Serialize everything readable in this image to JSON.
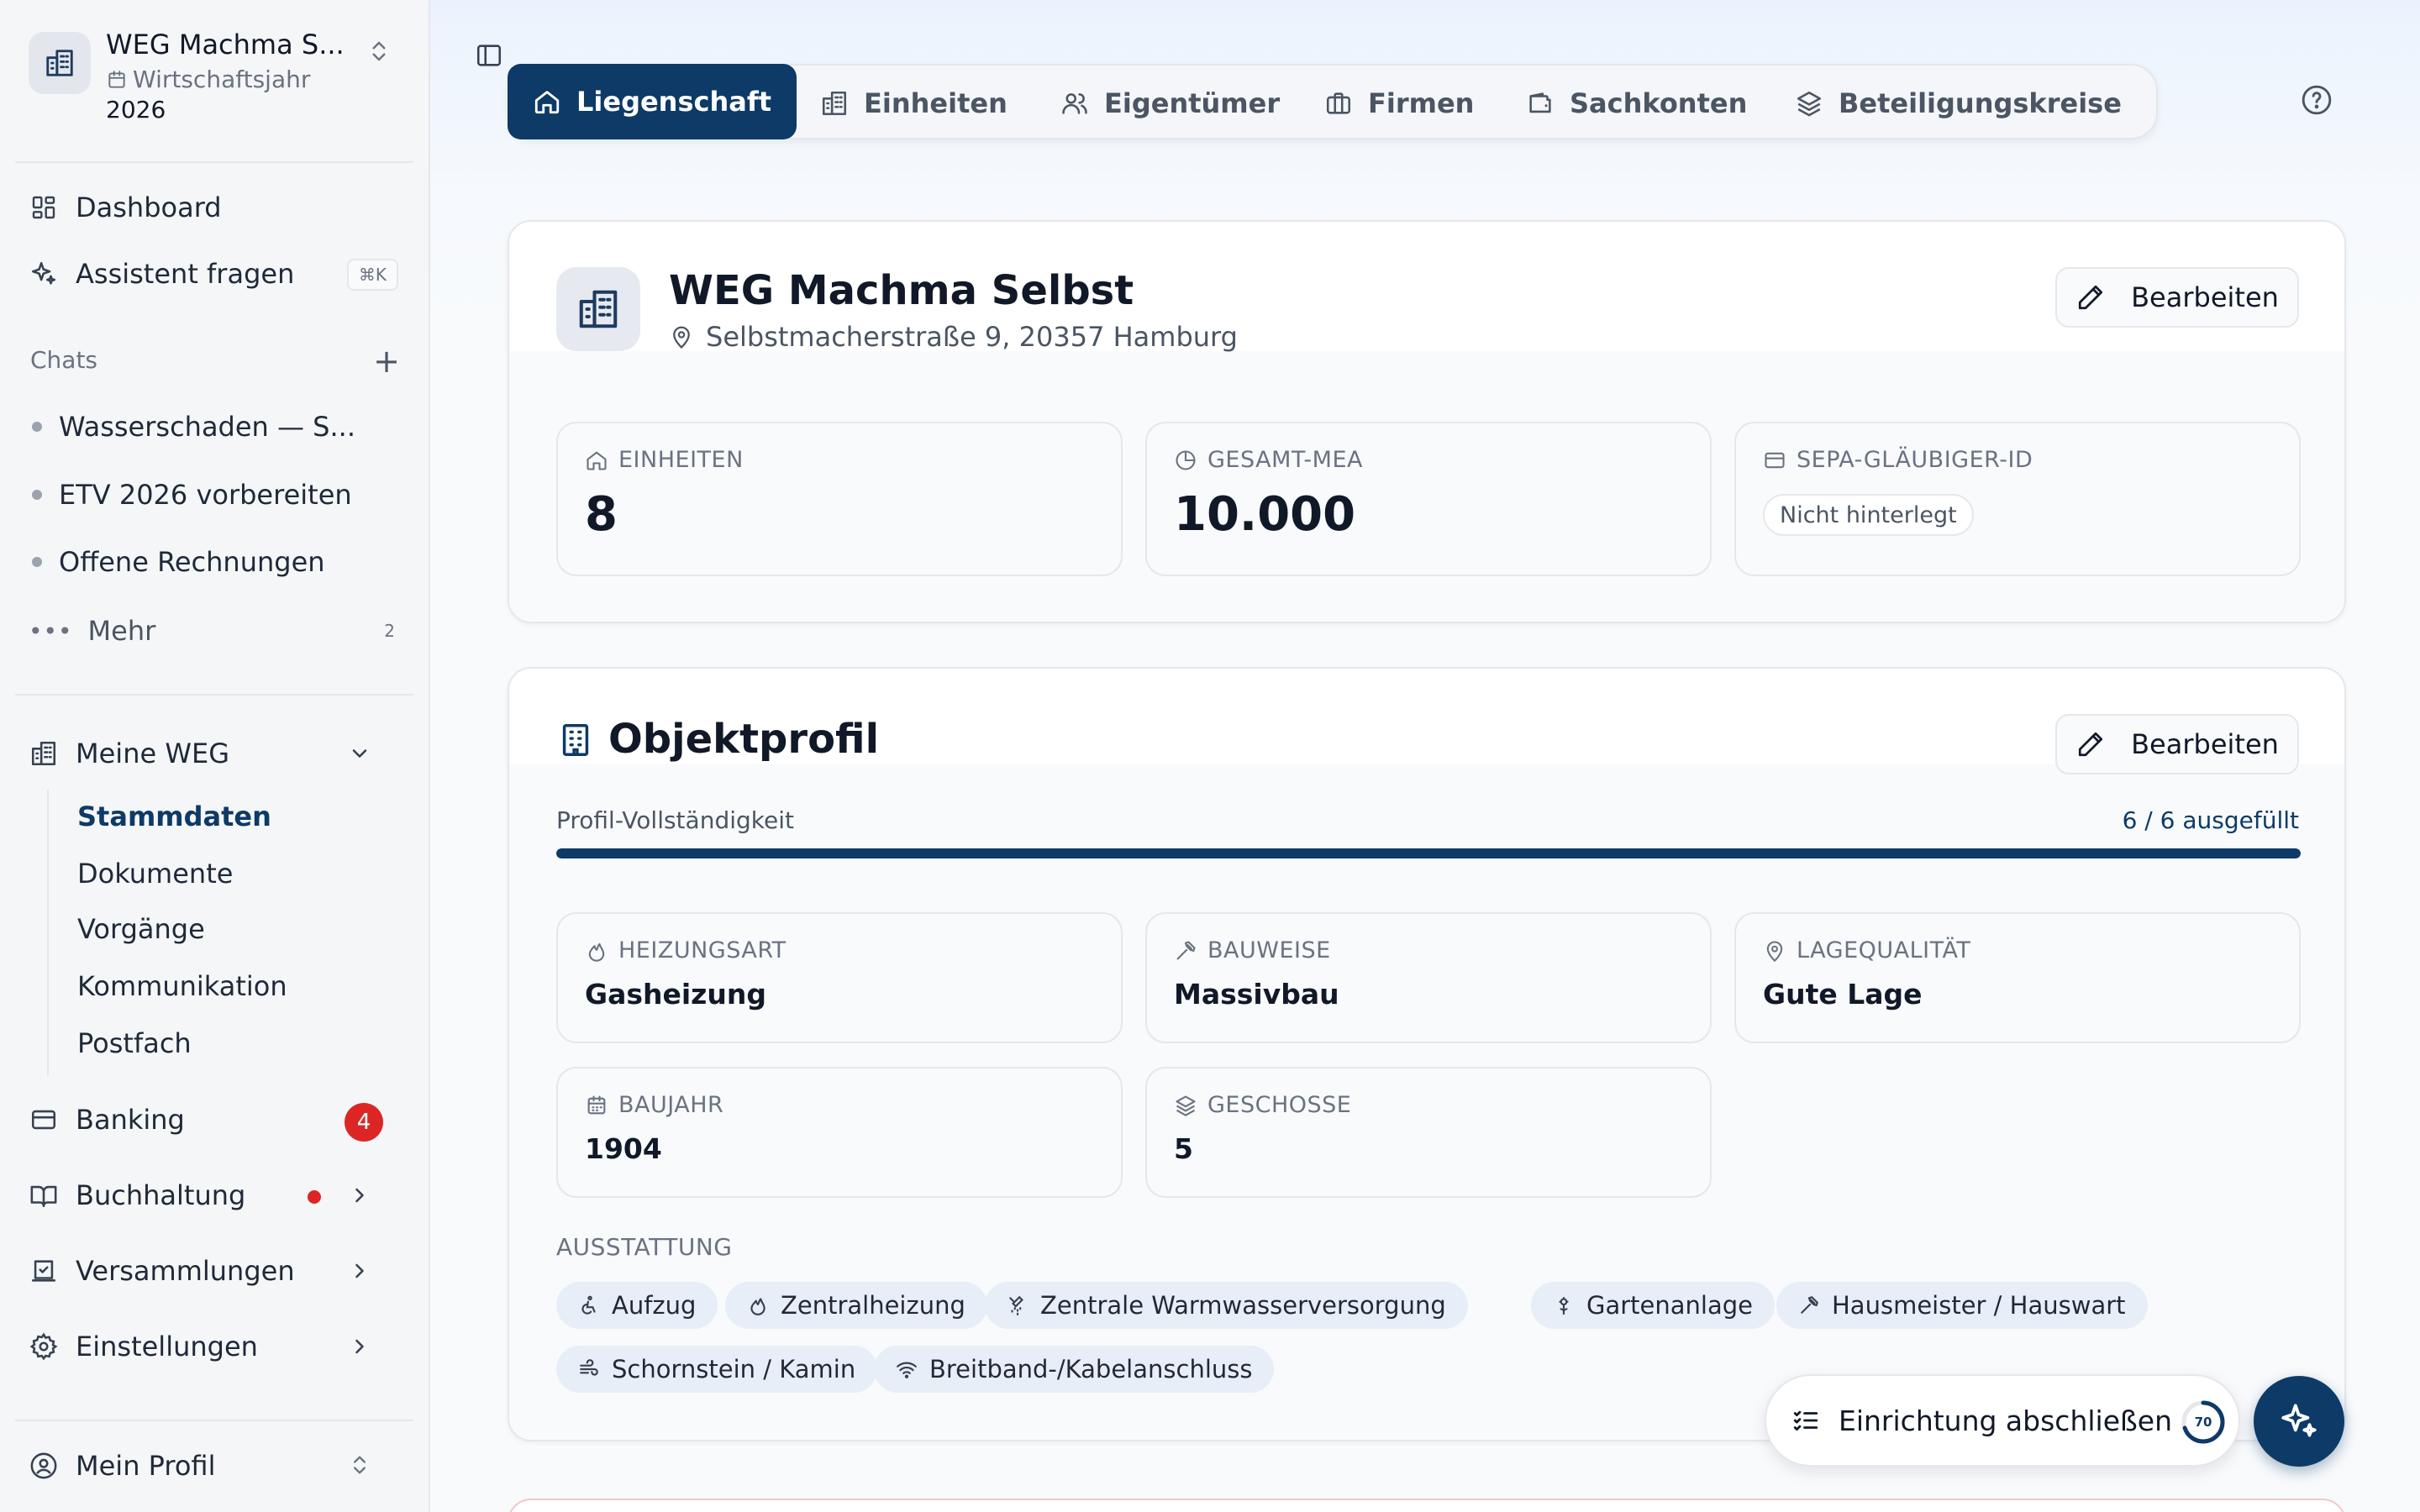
{
  "workspace": {
    "name": "WEG Machma S...",
    "fiscal_label": "Wirtschaftsjahr",
    "year": "2026"
  },
  "nav": {
    "dashboard": "Dashboard",
    "assistant": "Assistent fragen",
    "assistant_shortcut": "⌘K"
  },
  "chats": {
    "heading": "Chats",
    "items": [
      "Wasserschaden — S...",
      "ETV 2026 vorbereiten",
      "Offene Rechnungen"
    ],
    "more_label": "Mehr",
    "more_count": "2"
  },
  "meine_weg": {
    "label": "Meine WEG",
    "subitems": [
      "Stammdaten",
      "Dokumente",
      "Vorgänge",
      "Kommunikation",
      "Postfach"
    ],
    "active": "Stammdaten"
  },
  "sections": {
    "banking": "Banking",
    "banking_badge": "4",
    "buchhaltung": "Buchhaltung",
    "versammlungen": "Versammlungen",
    "einstellungen": "Einstellungen"
  },
  "profile": {
    "label": "Mein Profil"
  },
  "tabs": [
    "Liegenschaft",
    "Einheiten",
    "Eigentümer",
    "Firmen",
    "Sachkonten",
    "Beteiligungskreise"
  ],
  "active_tab": "Liegenschaft",
  "property": {
    "name": "WEG Machma Selbst",
    "address": "Selbstmacherstraße 9, 20357 Hamburg",
    "edit_label": "Bearbeiten",
    "stats": {
      "units_label": "EINHEITEN",
      "units_value": "8",
      "mea_label": "GESAMT-MEA",
      "mea_value": "10.000",
      "sepa_label": "SEPA-GLÄUBIGER-ID",
      "sepa_value": "Nicht hinterlegt"
    }
  },
  "objektprofil": {
    "title": "Objektprofil",
    "edit_label": "Bearbeiten",
    "progress_label": "Profil-Vollständigkeit",
    "progress_text": "6 / 6 ausgefüllt",
    "progress_fraction": 1.0,
    "fields": {
      "heizungsart_label": "HEIZUNGSART",
      "heizungsart_value": "Gasheizung",
      "bauweise_label": "BAUWEISE",
      "bauweise_value": "Massivbau",
      "lage_label": "LAGEQUALITÄT",
      "lage_value": "Gute Lage",
      "baujahr_label": "BAUJAHR",
      "baujahr_value": "1904",
      "geschosse_label": "GESCHOSSE",
      "geschosse_value": "5"
    },
    "ausstattung_label": "AUSSTATTUNG",
    "ausstattung": [
      "Aufzug",
      "Zentralheizung",
      "Zentrale Warmwasserversorgung",
      "Gartenanlage",
      "Hausmeister / Hauswart",
      "Schornstein / Kamin",
      "Breitband-/Kabelanschluss"
    ]
  },
  "setup": {
    "label": "Einrichtung abschließen",
    "progress": "70",
    "progress_fraction": 0.7
  },
  "colors": {
    "primary": "#0d3a66",
    "badge_red": "#dc2626",
    "chip_bg": "#e7eef7"
  },
  "icons": {
    "building": "building-icon",
    "calendar": "calendar-icon",
    "dashboard": "dashboard-grid-icon",
    "assistant": "sparkles-icon",
    "home": "home-icon",
    "users": "users-icon",
    "briefcase": "briefcase-icon",
    "wallet": "wallet-icon",
    "layers": "layers-icon",
    "help": "help-circle-icon",
    "edit": "pencil-icon",
    "pie": "pie-chart-icon",
    "card": "credit-card-icon",
    "flame": "flame-icon",
    "hammer": "hammer-icon",
    "pin": "map-pin-icon"
  }
}
